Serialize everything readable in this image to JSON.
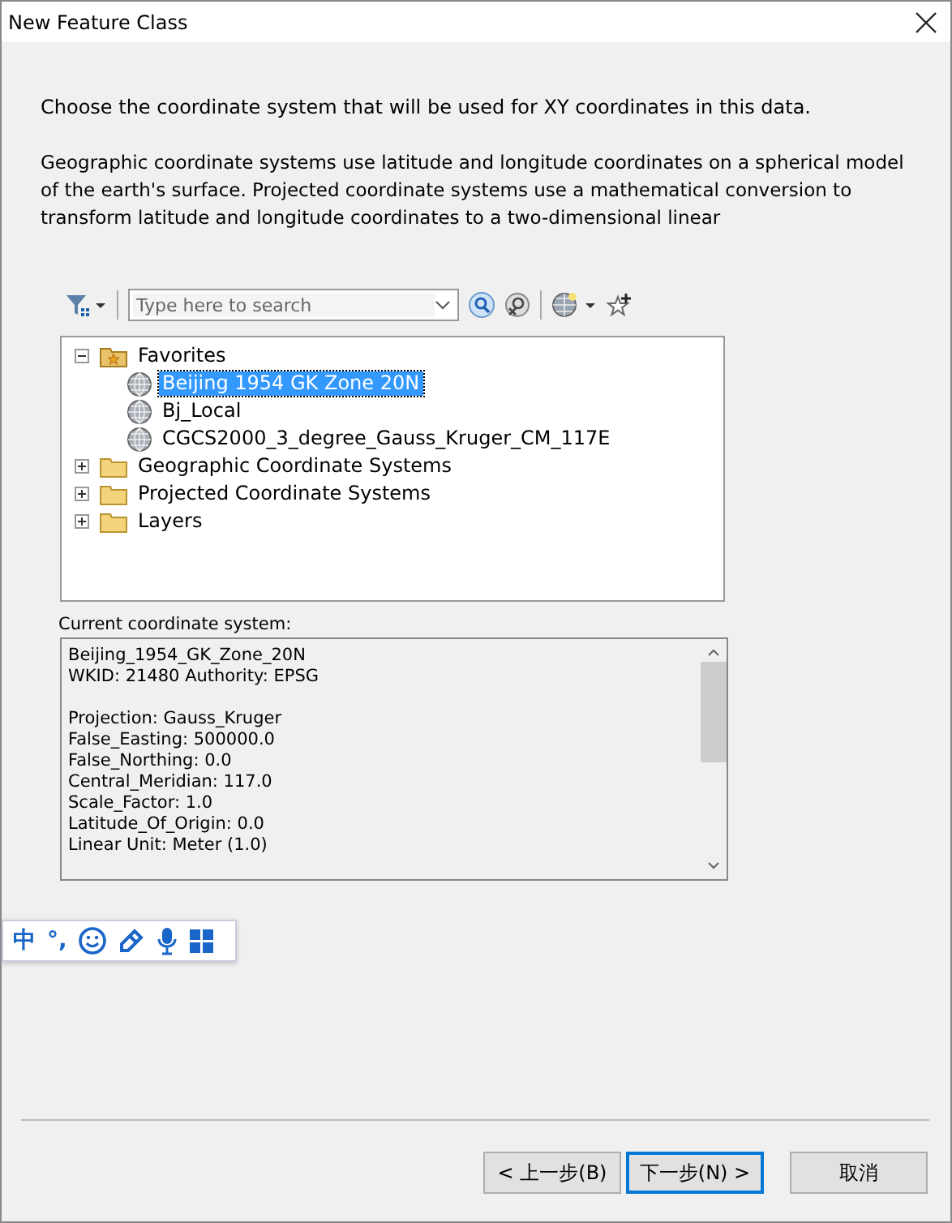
{
  "window": {
    "title": "New Feature Class"
  },
  "intro": "Choose the coordinate system that will be used for XY coordinates in this data.",
  "description": "Geographic coordinate systems use latitude and longitude coordinates on a spherical model of the earth's surface. Projected coordinate systems use a mathematical conversion to transform latitude and longitude coordinates to a two-dimensional linear",
  "search": {
    "placeholder": "Type here to search"
  },
  "tree": [
    {
      "label": "Favorites",
      "kind": "favorites",
      "expanded": true,
      "selected": false,
      "children": [
        {
          "label": "Beijing 1954 GK Zone 20N",
          "kind": "crs",
          "selected": true
        },
        {
          "label": "Bj_Local",
          "kind": "crs",
          "selected": false
        },
        {
          "label": "CGCS2000_3_degree_Gauss_Kruger_CM_117E",
          "kind": "crs",
          "selected": false
        }
      ]
    },
    {
      "label": "Geographic Coordinate Systems",
      "kind": "folder",
      "expanded": false,
      "selected": false
    },
    {
      "label": "Projected Coordinate Systems",
      "kind": "folder",
      "expanded": false,
      "selected": false
    },
    {
      "label": "Layers",
      "kind": "folder",
      "expanded": false,
      "selected": false
    }
  ],
  "current_label": "Current coordinate system:",
  "current_info": [
    [
      "Beijing_1954_GK_Zone_20N",
      "WKID: 21480 Authority: EPSG"
    ],
    [
      "Projection: Gauss_Kruger",
      "False_Easting: 500000.0",
      "False_Northing: 0.0",
      "Central_Meridian: 117.0",
      "Scale_Factor: 1.0",
      "Latitude_Of_Origin: 0.0",
      "Linear Unit: Meter (1.0)"
    ]
  ],
  "ime_toolbar": {
    "mode": "中",
    "punctuation": "°,"
  },
  "buttons": [
    {
      "label": "< 上一步(B)",
      "selected": false
    },
    {
      "label": "下一步(N) >",
      "selected": true
    },
    {
      "label": "取消",
      "selected": false
    }
  ]
}
